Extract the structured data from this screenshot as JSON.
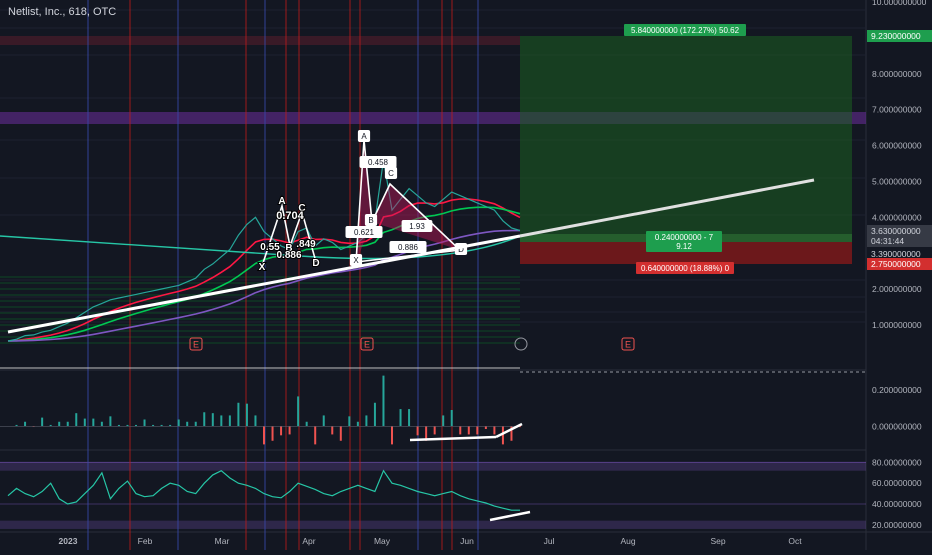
{
  "header": {
    "symbol": "Netlist, Inc., 618, OTC"
  },
  "colors": {
    "background": "#131722",
    "grid": "#1e222d",
    "bull": "#26a69a",
    "bear": "#ef5350",
    "profit_zone": "#1b5e20",
    "loss_zone": "#8b1a1a",
    "harmonic_fill": "#c2185b",
    "trendline": "#ffffff",
    "ema_fast": "#ff1744",
    "ema_mid": "#00c853",
    "ema_slow": "#7e57c2",
    "ema_long": "#26c6a6",
    "rsi_line": "#26c6a6",
    "rsi_band": "#7e57c2",
    "label_green": "#1e9e4e",
    "label_red": "#d32f2f"
  },
  "chart_data": [
    {
      "type": "line",
      "panel": "price",
      "title": "Netlist, Inc., 618, OTC",
      "x_tick_labels": [
        "2023",
        "Feb",
        "Mar",
        "Apr",
        "May",
        "Jun",
        "Jul",
        "Aug",
        "Sep",
        "Oct"
      ],
      "y_tick_labels": [
        "1.000000000",
        "2.000000000",
        "3.000000000",
        "4.000000000",
        "5.000000000",
        "6.000000000",
        "7.000000000",
        "8.000000000",
        "9.000000000",
        "10.000000000"
      ],
      "ylim": [
        0.3,
        10.0
      ],
      "series": [
        {
          "values": [
            0.55,
            0.6,
            0.7,
            0.72,
            0.8,
            0.85,
            0.95,
            1.05,
            1.2,
            1.35,
            1.5,
            1.6,
            1.7,
            1.75,
            1.8,
            1.85,
            1.9,
            1.95,
            2.0,
            2.05,
            2.1,
            2.2,
            2.3,
            2.55,
            2.7,
            2.9,
            3.1,
            3.5,
            3.8,
            4.0,
            3.6,
            3.4,
            3.2,
            3.1,
            3.6,
            3.7,
            3.2,
            3.4,
            3.3,
            3.1,
            3.2,
            3.3,
            3.5,
            3.9,
            5.6,
            4.2,
            4.5,
            4.8,
            4.6,
            4.4,
            4.3,
            4.5,
            4.7,
            4.6,
            4.5,
            4.4,
            4.3,
            4.2,
            3.9,
            3.7,
            3.63
          ]
        }
      ],
      "price_labels": [
        "9.230000000",
        "3.630000000",
        "04:31:44",
        "3.390000000",
        "2.750000000"
      ],
      "earnings_markers": [
        "E",
        "E",
        "E"
      ],
      "harmonic_small": {
        "points": [
          "X",
          "A",
          "B",
          "C",
          "D"
        ],
        "ratios": [
          "0.704",
          "0.55",
          "0.886",
          ".849"
        ]
      },
      "harmonic_large": {
        "points": [
          "X",
          "A",
          "B",
          "C",
          "D"
        ],
        "ratios": [
          "0.458",
          "0.621",
          "1.93",
          "0.886"
        ]
      },
      "targets": {
        "profit": "5.840000000 (172.27%) 50.62",
        "entry_line1": "0.240000000 - 7",
        "entry_line2": "9.12",
        "stop": "0.640000000 (18.88%) 0"
      }
    },
    {
      "type": "bar",
      "panel": "oscillator",
      "y_tick_labels": [
        "0.200000000",
        "0.000000000"
      ],
      "ylim": [
        -0.12,
        0.3
      ]
    },
    {
      "type": "line",
      "panel": "rsi",
      "y_tick_labels": [
        "20.00000000",
        "40.00000000",
        "60.00000000",
        "80.00000000"
      ],
      "ylim": [
        15,
        90
      ],
      "values": [
        48,
        55,
        50,
        47,
        52,
        60,
        45,
        40,
        42,
        50,
        58,
        70,
        45,
        55,
        62,
        50,
        47,
        48,
        55,
        60,
        58,
        52,
        50,
        60,
        68,
        72,
        65,
        60,
        58,
        55,
        50,
        47,
        46,
        52,
        60,
        57,
        54,
        50,
        48,
        52,
        55,
        58,
        55,
        52,
        72,
        60,
        58,
        55,
        52,
        50,
        48,
        50,
        52,
        48,
        45,
        43,
        41,
        38,
        36,
        34,
        34
      ]
    }
  ]
}
